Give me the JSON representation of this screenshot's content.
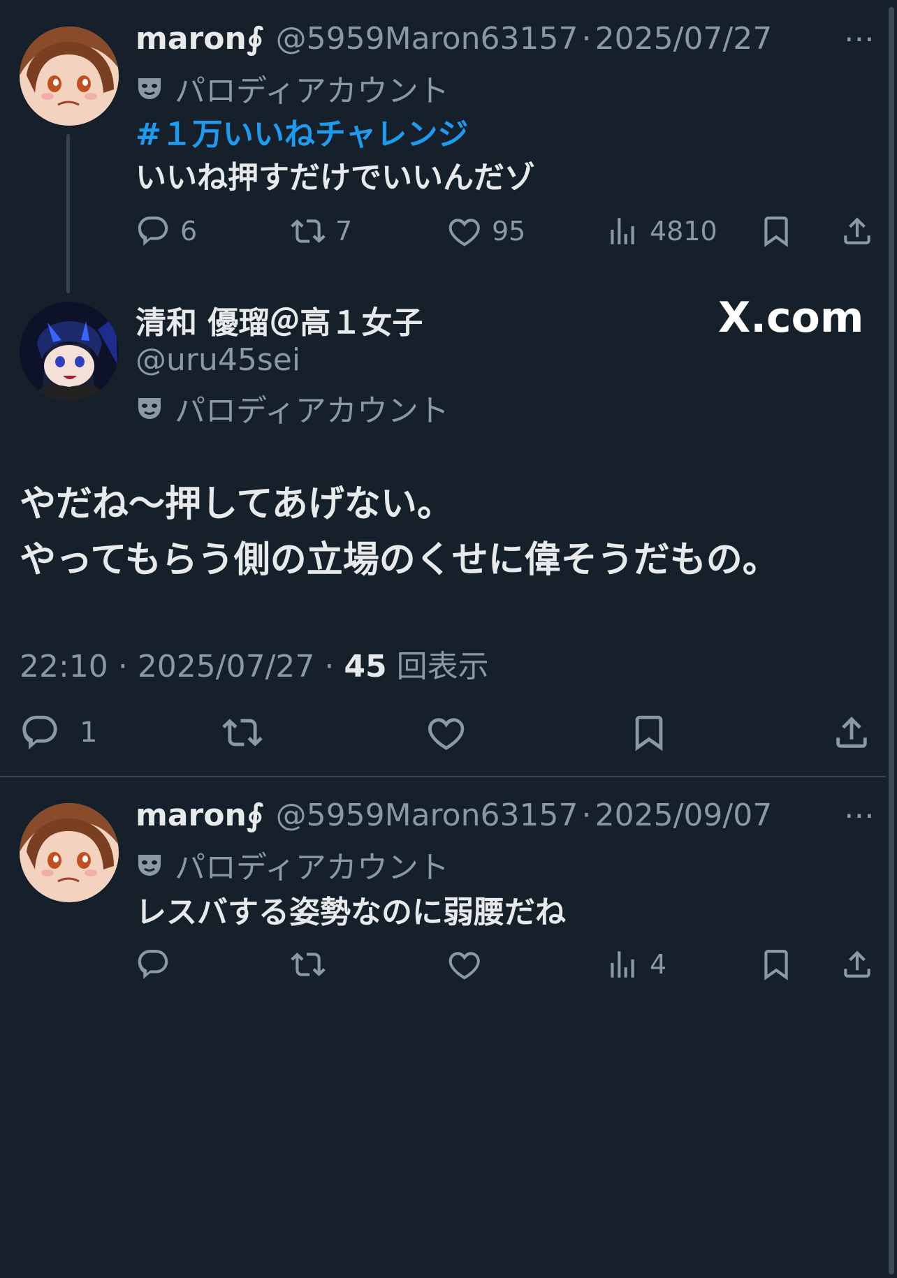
{
  "tweet1": {
    "name": "maron∮",
    "handle": "@5959Maron63157",
    "date": "2025/07/27",
    "parody_label": "パロディアカウント",
    "hashtag": "#１万いいねチャレンジ",
    "text": "いいね押すだけでいいんだゾ",
    "replies": "6",
    "retweets": "7",
    "likes": "95",
    "views": "4810"
  },
  "main_tweet": {
    "name": "清和 優瑠＠高１女子",
    "handle": "@uru45sei",
    "parody_label": "パロディアカウント",
    "line1": "やだね〜押してあげない。",
    "line2": "やってもらう側の立場のくせに偉そうだもの。",
    "time": "22:10",
    "date": "2025/07/27",
    "views_count": "45",
    "views_label": "回表示",
    "replies": "1"
  },
  "watermark": "X.com",
  "tweet3": {
    "name": "maron∮",
    "handle": "@5959Maron63157",
    "date": "2025/09/07",
    "parody_label": "パロディアカウント",
    "text": "レスバする姿勢なのに弱腰だね",
    "views": "4"
  },
  "separator": "·",
  "more_icon": "⋯"
}
